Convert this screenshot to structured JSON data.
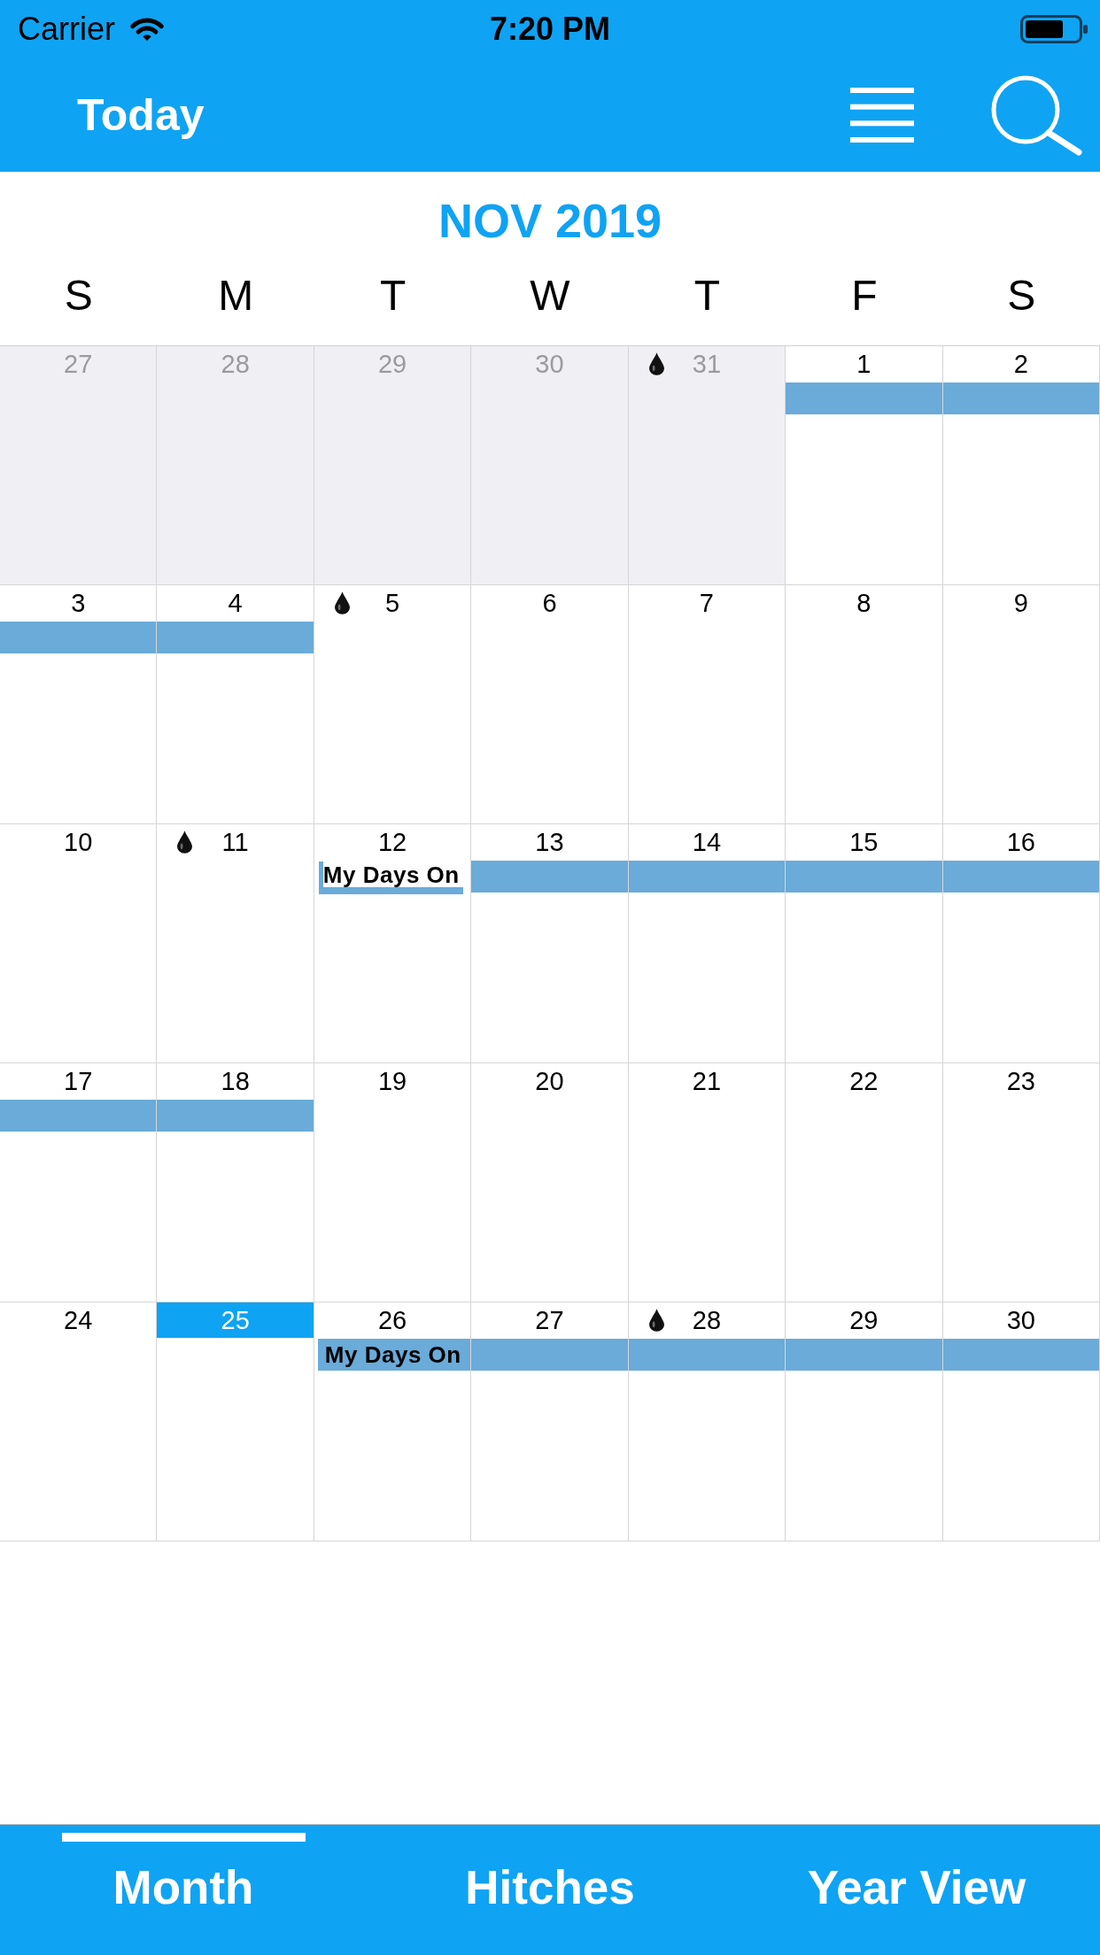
{
  "status_bar": {
    "carrier": "Carrier",
    "time": "7:20 PM"
  },
  "header": {
    "title": "Today"
  },
  "calendar": {
    "month_title": "NOV 2019",
    "weekdays": [
      "S",
      "M",
      "T",
      "W",
      "T",
      "F",
      "S"
    ],
    "weeks": [
      {
        "days": [
          {
            "day": "27",
            "in_month": false,
            "today": false,
            "marked": false
          },
          {
            "day": "28",
            "in_month": false,
            "today": false,
            "marked": false
          },
          {
            "day": "29",
            "in_month": false,
            "today": false,
            "marked": false
          },
          {
            "day": "30",
            "in_month": false,
            "today": false,
            "marked": false
          },
          {
            "day": "31",
            "in_month": false,
            "today": false,
            "marked": true
          },
          {
            "day": "1",
            "in_month": true,
            "today": false,
            "marked": false,
            "event": {
              "kind": "bar"
            }
          },
          {
            "day": "2",
            "in_month": true,
            "today": false,
            "marked": false,
            "event": {
              "kind": "bar"
            }
          }
        ]
      },
      {
        "days": [
          {
            "day": "3",
            "in_month": true,
            "today": false,
            "marked": false,
            "event": {
              "kind": "bar"
            }
          },
          {
            "day": "4",
            "in_month": true,
            "today": false,
            "marked": false,
            "event": {
              "kind": "bar"
            }
          },
          {
            "day": "5",
            "in_month": true,
            "today": false,
            "marked": true
          },
          {
            "day": "6",
            "in_month": true,
            "today": false,
            "marked": false
          },
          {
            "day": "7",
            "in_month": true,
            "today": false,
            "marked": false
          },
          {
            "day": "8",
            "in_month": true,
            "today": false,
            "marked": false
          },
          {
            "day": "9",
            "in_month": true,
            "today": false,
            "marked": false
          }
        ]
      },
      {
        "days": [
          {
            "day": "10",
            "in_month": true,
            "today": false,
            "marked": false
          },
          {
            "day": "11",
            "in_month": true,
            "today": false,
            "marked": true
          },
          {
            "day": "12",
            "in_month": true,
            "today": false,
            "marked": false,
            "event": {
              "kind": "boxed",
              "label": "My Days On"
            }
          },
          {
            "day": "13",
            "in_month": true,
            "today": false,
            "marked": false,
            "event": {
              "kind": "bar"
            }
          },
          {
            "day": "14",
            "in_month": true,
            "today": false,
            "marked": false,
            "event": {
              "kind": "bar"
            }
          },
          {
            "day": "15",
            "in_month": true,
            "today": false,
            "marked": false,
            "event": {
              "kind": "bar"
            }
          },
          {
            "day": "16",
            "in_month": true,
            "today": false,
            "marked": false,
            "event": {
              "kind": "bar"
            }
          }
        ]
      },
      {
        "days": [
          {
            "day": "17",
            "in_month": true,
            "today": false,
            "marked": false,
            "event": {
              "kind": "bar"
            }
          },
          {
            "day": "18",
            "in_month": true,
            "today": false,
            "marked": false,
            "event": {
              "kind": "bar"
            }
          },
          {
            "day": "19",
            "in_month": true,
            "today": false,
            "marked": false
          },
          {
            "day": "20",
            "in_month": true,
            "today": false,
            "marked": false
          },
          {
            "day": "21",
            "in_month": true,
            "today": false,
            "marked": false
          },
          {
            "day": "22",
            "in_month": true,
            "today": false,
            "marked": false
          },
          {
            "day": "23",
            "in_month": true,
            "today": false,
            "marked": false
          }
        ]
      },
      {
        "days": [
          {
            "day": "24",
            "in_month": true,
            "today": false,
            "marked": false
          },
          {
            "day": "25",
            "in_month": true,
            "today": true,
            "marked": false
          },
          {
            "day": "26",
            "in_month": true,
            "today": false,
            "marked": false,
            "event": {
              "kind": "titled",
              "label": "My Days On"
            }
          },
          {
            "day": "27",
            "in_month": true,
            "today": false,
            "marked": false,
            "event": {
              "kind": "bar"
            }
          },
          {
            "day": "28",
            "in_month": true,
            "today": false,
            "marked": true,
            "event": {
              "kind": "bar"
            }
          },
          {
            "day": "29",
            "in_month": true,
            "today": false,
            "marked": false,
            "event": {
              "kind": "bar"
            }
          },
          {
            "day": "30",
            "in_month": true,
            "today": false,
            "marked": false,
            "event": {
              "kind": "bar"
            }
          }
        ]
      }
    ]
  },
  "tab_bar": {
    "tabs": [
      {
        "label": "Month",
        "selected": true
      },
      {
        "label": "Hitches",
        "selected": false
      },
      {
        "label": "Year View",
        "selected": false
      }
    ]
  }
}
